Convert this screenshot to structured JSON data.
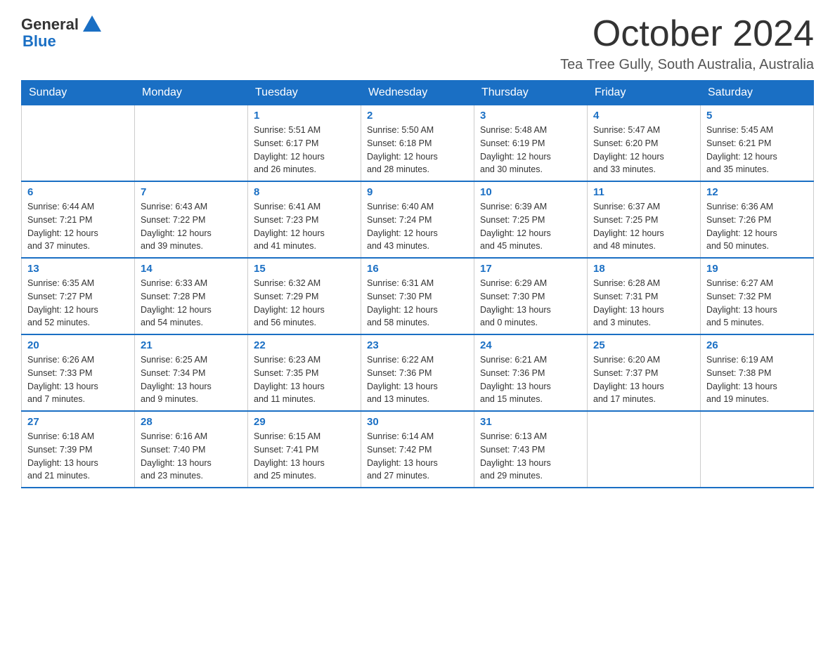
{
  "header": {
    "logo": {
      "general": "General",
      "blue": "Blue"
    },
    "month": "October 2024",
    "location": "Tea Tree Gully, South Australia, Australia"
  },
  "weekdays": [
    "Sunday",
    "Monday",
    "Tuesday",
    "Wednesday",
    "Thursday",
    "Friday",
    "Saturday"
  ],
  "weeks": [
    [
      {
        "day": "",
        "info": ""
      },
      {
        "day": "",
        "info": ""
      },
      {
        "day": "1",
        "info": "Sunrise: 5:51 AM\nSunset: 6:17 PM\nDaylight: 12 hours\nand 26 minutes."
      },
      {
        "day": "2",
        "info": "Sunrise: 5:50 AM\nSunset: 6:18 PM\nDaylight: 12 hours\nand 28 minutes."
      },
      {
        "day": "3",
        "info": "Sunrise: 5:48 AM\nSunset: 6:19 PM\nDaylight: 12 hours\nand 30 minutes."
      },
      {
        "day": "4",
        "info": "Sunrise: 5:47 AM\nSunset: 6:20 PM\nDaylight: 12 hours\nand 33 minutes."
      },
      {
        "day": "5",
        "info": "Sunrise: 5:45 AM\nSunset: 6:21 PM\nDaylight: 12 hours\nand 35 minutes."
      }
    ],
    [
      {
        "day": "6",
        "info": "Sunrise: 6:44 AM\nSunset: 7:21 PM\nDaylight: 12 hours\nand 37 minutes."
      },
      {
        "day": "7",
        "info": "Sunrise: 6:43 AM\nSunset: 7:22 PM\nDaylight: 12 hours\nand 39 minutes."
      },
      {
        "day": "8",
        "info": "Sunrise: 6:41 AM\nSunset: 7:23 PM\nDaylight: 12 hours\nand 41 minutes."
      },
      {
        "day": "9",
        "info": "Sunrise: 6:40 AM\nSunset: 7:24 PM\nDaylight: 12 hours\nand 43 minutes."
      },
      {
        "day": "10",
        "info": "Sunrise: 6:39 AM\nSunset: 7:25 PM\nDaylight: 12 hours\nand 45 minutes."
      },
      {
        "day": "11",
        "info": "Sunrise: 6:37 AM\nSunset: 7:25 PM\nDaylight: 12 hours\nand 48 minutes."
      },
      {
        "day": "12",
        "info": "Sunrise: 6:36 AM\nSunset: 7:26 PM\nDaylight: 12 hours\nand 50 minutes."
      }
    ],
    [
      {
        "day": "13",
        "info": "Sunrise: 6:35 AM\nSunset: 7:27 PM\nDaylight: 12 hours\nand 52 minutes."
      },
      {
        "day": "14",
        "info": "Sunrise: 6:33 AM\nSunset: 7:28 PM\nDaylight: 12 hours\nand 54 minutes."
      },
      {
        "day": "15",
        "info": "Sunrise: 6:32 AM\nSunset: 7:29 PM\nDaylight: 12 hours\nand 56 minutes."
      },
      {
        "day": "16",
        "info": "Sunrise: 6:31 AM\nSunset: 7:30 PM\nDaylight: 12 hours\nand 58 minutes."
      },
      {
        "day": "17",
        "info": "Sunrise: 6:29 AM\nSunset: 7:30 PM\nDaylight: 13 hours\nand 0 minutes."
      },
      {
        "day": "18",
        "info": "Sunrise: 6:28 AM\nSunset: 7:31 PM\nDaylight: 13 hours\nand 3 minutes."
      },
      {
        "day": "19",
        "info": "Sunrise: 6:27 AM\nSunset: 7:32 PM\nDaylight: 13 hours\nand 5 minutes."
      }
    ],
    [
      {
        "day": "20",
        "info": "Sunrise: 6:26 AM\nSunset: 7:33 PM\nDaylight: 13 hours\nand 7 minutes."
      },
      {
        "day": "21",
        "info": "Sunrise: 6:25 AM\nSunset: 7:34 PM\nDaylight: 13 hours\nand 9 minutes."
      },
      {
        "day": "22",
        "info": "Sunrise: 6:23 AM\nSunset: 7:35 PM\nDaylight: 13 hours\nand 11 minutes."
      },
      {
        "day": "23",
        "info": "Sunrise: 6:22 AM\nSunset: 7:36 PM\nDaylight: 13 hours\nand 13 minutes."
      },
      {
        "day": "24",
        "info": "Sunrise: 6:21 AM\nSunset: 7:36 PM\nDaylight: 13 hours\nand 15 minutes."
      },
      {
        "day": "25",
        "info": "Sunrise: 6:20 AM\nSunset: 7:37 PM\nDaylight: 13 hours\nand 17 minutes."
      },
      {
        "day": "26",
        "info": "Sunrise: 6:19 AM\nSunset: 7:38 PM\nDaylight: 13 hours\nand 19 minutes."
      }
    ],
    [
      {
        "day": "27",
        "info": "Sunrise: 6:18 AM\nSunset: 7:39 PM\nDaylight: 13 hours\nand 21 minutes."
      },
      {
        "day": "28",
        "info": "Sunrise: 6:16 AM\nSunset: 7:40 PM\nDaylight: 13 hours\nand 23 minutes."
      },
      {
        "day": "29",
        "info": "Sunrise: 6:15 AM\nSunset: 7:41 PM\nDaylight: 13 hours\nand 25 minutes."
      },
      {
        "day": "30",
        "info": "Sunrise: 6:14 AM\nSunset: 7:42 PM\nDaylight: 13 hours\nand 27 minutes."
      },
      {
        "day": "31",
        "info": "Sunrise: 6:13 AM\nSunset: 7:43 PM\nDaylight: 13 hours\nand 29 minutes."
      },
      {
        "day": "",
        "info": ""
      },
      {
        "day": "",
        "info": ""
      }
    ]
  ]
}
